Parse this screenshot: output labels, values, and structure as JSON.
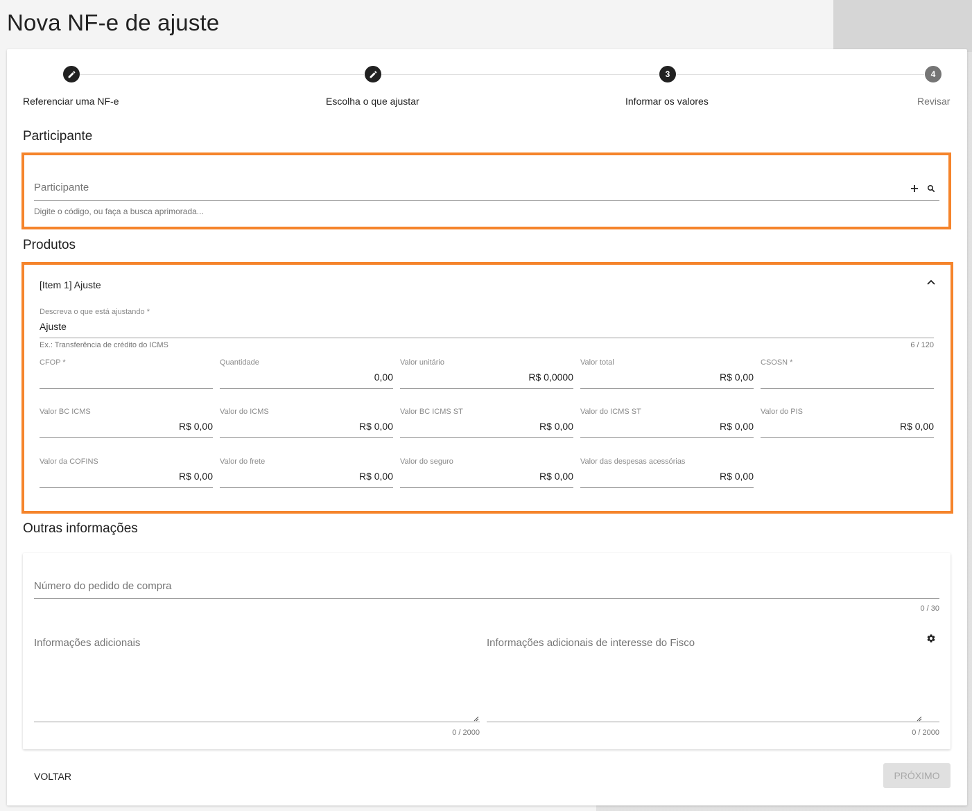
{
  "page": {
    "title": "Nova NF-e de ajuste"
  },
  "stepper": {
    "steps": [
      {
        "label": "Referenciar uma NF-e",
        "marker": "pencil-icon",
        "state": "done"
      },
      {
        "label": "Escolha o que ajustar",
        "marker": "pencil-icon",
        "state": "done"
      },
      {
        "label": "Informar os valores",
        "number": "3",
        "state": "active"
      },
      {
        "label": "Revisar",
        "number": "4",
        "state": "inactive"
      }
    ]
  },
  "participante": {
    "section_title": "Participante",
    "field_label": "Participante",
    "hint": "Digite o código, ou faça a busca aprimorada...",
    "icons": [
      "plus-icon",
      "search-icon"
    ]
  },
  "produtos": {
    "section_title": "Produtos",
    "item_title": "[Item 1] Ajuste",
    "description": {
      "label": "Descreva o que está ajustando *",
      "value": "Ajuste",
      "hint": "Ex.: Transferência de crédito do ICMS",
      "counter": "6 / 120"
    },
    "fields": [
      {
        "label": "CFOP *",
        "value": ""
      },
      {
        "label": "Quantidade",
        "value": "0,00"
      },
      {
        "label": "Valor unitário",
        "value": "R$ 0,0000"
      },
      {
        "label": "Valor total",
        "value": "R$ 0,00"
      },
      {
        "label": "CSOSN *",
        "value": ""
      },
      {
        "label": "Valor BC ICMS",
        "value": "R$ 0,00"
      },
      {
        "label": "Valor do ICMS",
        "value": "R$ 0,00"
      },
      {
        "label": "Valor BC ICMS ST",
        "value": "R$ 0,00"
      },
      {
        "label": "Valor do ICMS ST",
        "value": "R$ 0,00"
      },
      {
        "label": "Valor do PIS",
        "value": "R$ 0,00"
      },
      {
        "label": "Valor da COFINS",
        "value": "R$ 0,00"
      },
      {
        "label": "Valor do frete",
        "value": "R$ 0,00"
      },
      {
        "label": "Valor do seguro",
        "value": "R$ 0,00"
      },
      {
        "label": "Valor das despesas acessórias",
        "value": "R$ 0,00"
      }
    ]
  },
  "outras": {
    "section_title": "Outras informações",
    "pedido": {
      "label": "Número do pedido de compra",
      "counter": "0 / 30"
    },
    "info_adicionais": {
      "label": "Informações adicionais",
      "counter": "0 / 2000"
    },
    "info_fisco": {
      "label": "Informações adicionais de interesse do Fisco",
      "counter": "0 / 2000"
    }
  },
  "actions": {
    "back": "VOLTAR",
    "next": "PRÓXIMO"
  },
  "colors": {
    "highlight": "#f5842b",
    "step_active": "#212121",
    "step_inactive": "#757575"
  }
}
